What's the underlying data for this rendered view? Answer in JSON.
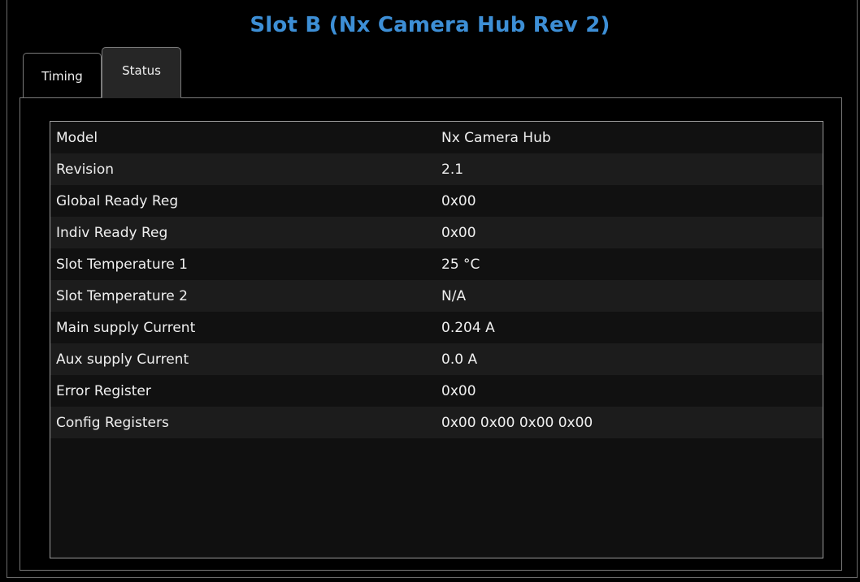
{
  "header": {
    "title": "Slot B (Nx Camera Hub Rev 2)"
  },
  "tabs": [
    {
      "label": "Timing",
      "selected": false
    },
    {
      "label": "Status",
      "selected": true
    }
  ],
  "status_table": {
    "rows": [
      {
        "key": "Model",
        "value": "Nx Camera Hub"
      },
      {
        "key": "Revision",
        "value": "2.1"
      },
      {
        "key": "Global Ready Reg",
        "value": "0x00"
      },
      {
        "key": "Indiv Ready Reg",
        "value": "0x00"
      },
      {
        "key": "Slot Temperature 1",
        "value": "25 °C"
      },
      {
        "key": "Slot Temperature 2",
        "value": "N/A"
      },
      {
        "key": "Main supply Current",
        "value": "0.204 A"
      },
      {
        "key": "Aux supply Current",
        "value": "0.0 A"
      },
      {
        "key": "Error Register",
        "value": "0x00"
      },
      {
        "key": "Config Registers",
        "value": "0x00 0x00 0x00 0x00"
      }
    ]
  },
  "colors": {
    "title": "#3d8fd6",
    "background": "#000000",
    "row_alt": "#1c1c1c"
  }
}
